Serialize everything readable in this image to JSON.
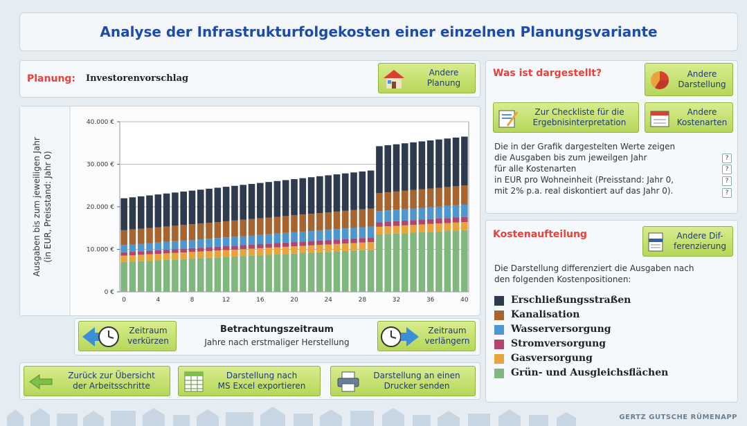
{
  "header": {
    "title": "Analyse der Infrastrukturfolgekosten einer einzelnen Planungsvariante"
  },
  "planung": {
    "label": "Planung:",
    "value": "Investorenvorschlag",
    "button": [
      "Andere",
      "Planung"
    ]
  },
  "dargestellt": {
    "title": "Was ist dargestellt?",
    "btn_darstellung": [
      "Andere",
      "Darstellung"
    ],
    "btn_checkliste": [
      "Zur Checkliste für die",
      "Ergebnisinterpretation"
    ],
    "btn_kostenarten": [
      "Andere",
      "Kostenarten"
    ],
    "info_lines": [
      "Die in der Grafik dargestelten Werte zeigen",
      "die Ausgaben bis zum jeweilgen Jahr",
      "für alle Kostenarten",
      "in EUR pro Wohneinheit (Preisstand: Jahr 0,",
      "mit 2% p.a. real diskontiert auf das Jahr 0)."
    ],
    "help_icon": "?"
  },
  "kosten": {
    "title": "Kostenaufteilung",
    "button": [
      "Andere Dif-",
      "ferenzierung"
    ],
    "desc": [
      "Die Darstellung differenziert die Ausgaben nach",
      "den folgenden Kostenpositionen:"
    ],
    "legend": [
      {
        "name": "Erschließungsstraßen",
        "color": "#2e3b4e"
      },
      {
        "name": "Kanalisation",
        "color": "#a8642e"
      },
      {
        "name": "Wasserversorgung",
        "color": "#4d96cf"
      },
      {
        "name": "Stromversorgung",
        "color": "#b0476a"
      },
      {
        "name": "Gasversorgung",
        "color": "#e8a33c"
      },
      {
        "name": "Grün- und Ausgleichsflächen",
        "color": "#7fb77e"
      }
    ]
  },
  "zeitraum": {
    "title": "Betrachtungszeitraum",
    "subtitle": "Jahre nach erstmaliger Herstellung",
    "btn_shorten": [
      "Zeitraum",
      "verkürzen"
    ],
    "btn_extend": [
      "Zeitraum",
      "verlängern"
    ]
  },
  "bottom": {
    "btn_back": [
      "Zurück zur Übersicht",
      "der Arbeitsschritte"
    ],
    "btn_excel": [
      "Darstellung nach",
      "MS Excel exportieren"
    ],
    "btn_print": [
      "Darstellung an einen",
      "Drucker senden"
    ]
  },
  "footer": {
    "brand": "GERTZ GUTSCHE RÜMENAPP"
  },
  "chart_data": {
    "type": "bar",
    "stacked": true,
    "ylabel": [
      "Ausgaben bis zum jeweiligen Jahr",
      "(in EUR, Preisstand: Jahr 0)"
    ],
    "ylim": [
      0,
      40000
    ],
    "yticks": [
      0,
      10000,
      20000,
      30000,
      40000
    ],
    "ytick_labels": [
      "0 €",
      "10.000 €",
      "20.000 €",
      "30.000 €",
      "40.000 €"
    ],
    "xticks": [
      0,
      4,
      8,
      12,
      16,
      20,
      24,
      28,
      32,
      36,
      40
    ],
    "x": [
      0,
      1,
      2,
      3,
      4,
      5,
      6,
      7,
      8,
      9,
      10,
      11,
      12,
      13,
      14,
      15,
      16,
      17,
      18,
      19,
      20,
      21,
      22,
      23,
      24,
      25,
      26,
      27,
      28,
      29,
      30,
      31,
      32,
      33,
      34,
      35,
      36,
      37,
      38,
      39,
      40
    ],
    "series": [
      {
        "name": "Grün- und Ausgleichsflächen",
        "color": "#7fb77e",
        "values": [
          7000,
          7100,
          7200,
          7300,
          7400,
          7500,
          7600,
          7700,
          7800,
          7900,
          8000,
          8100,
          8200,
          8300,
          8400,
          8500,
          8600,
          8700,
          8800,
          8900,
          9000,
          9100,
          9200,
          9300,
          9400,
          9500,
          9600,
          9700,
          9800,
          9900,
          13500,
          13600,
          13700,
          13800,
          13900,
          14000,
          14100,
          14200,
          14300,
          14400,
          14500
        ]
      },
      {
        "name": "Gasversorgung",
        "color": "#e8a33c",
        "values": [
          1500,
          1510,
          1520,
          1530,
          1540,
          1550,
          1560,
          1570,
          1580,
          1590,
          1600,
          1610,
          1620,
          1630,
          1640,
          1650,
          1660,
          1670,
          1680,
          1690,
          1700,
          1710,
          1720,
          1730,
          1740,
          1750,
          1760,
          1770,
          1780,
          1790,
          1800,
          1810,
          1820,
          1830,
          1840,
          1850,
          1860,
          1870,
          1880,
          1890,
          1900
        ]
      },
      {
        "name": "Stromversorgung",
        "color": "#b0476a",
        "values": [
          800,
          810,
          820,
          830,
          840,
          850,
          860,
          870,
          880,
          890,
          900,
          910,
          920,
          930,
          940,
          950,
          960,
          970,
          980,
          990,
          1000,
          1010,
          1020,
          1030,
          1040,
          1050,
          1060,
          1070,
          1080,
          1090,
          1100,
          1110,
          1120,
          1130,
          1140,
          1150,
          1160,
          1170,
          1180,
          1190,
          1200
        ]
      },
      {
        "name": "Wasserversorgung",
        "color": "#4d96cf",
        "values": [
          1700,
          1730,
          1760,
          1790,
          1820,
          1850,
          1880,
          1910,
          1940,
          1970,
          2000,
          2030,
          2060,
          2090,
          2120,
          2150,
          2180,
          2210,
          2240,
          2270,
          2300,
          2330,
          2360,
          2390,
          2420,
          2450,
          2480,
          2510,
          2540,
          2570,
          2600,
          2630,
          2660,
          2690,
          2720,
          2750,
          2780,
          2810,
          2840,
          2870,
          2900
        ]
      },
      {
        "name": "Kanalisation",
        "color": "#a8642e",
        "values": [
          3500,
          3525,
          3550,
          3575,
          3600,
          3625,
          3650,
          3675,
          3700,
          3725,
          3750,
          3775,
          3800,
          3825,
          3850,
          3875,
          3900,
          3925,
          3950,
          3975,
          4000,
          4025,
          4050,
          4075,
          4100,
          4125,
          4150,
          4175,
          4200,
          4225,
          4250,
          4275,
          4300,
          4325,
          4350,
          4375,
          4400,
          4425,
          4450,
          4475,
          4500
        ]
      },
      {
        "name": "Erschließungsstraßen",
        "color": "#2e3b4e",
        "values": [
          7500,
          7550,
          7600,
          7650,
          7700,
          7750,
          7800,
          7850,
          7900,
          7950,
          8000,
          8050,
          8100,
          8150,
          8200,
          8250,
          8300,
          8350,
          8400,
          8450,
          8500,
          8550,
          8600,
          8650,
          8700,
          8750,
          8800,
          8850,
          8900,
          8950,
          11000,
          11050,
          11100,
          11150,
          11200,
          11250,
          11300,
          11350,
          11400,
          11450,
          11500
        ]
      }
    ]
  }
}
